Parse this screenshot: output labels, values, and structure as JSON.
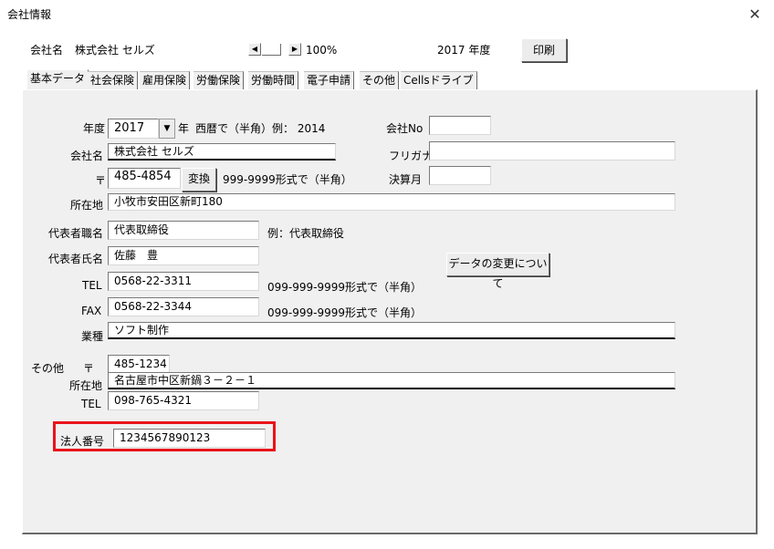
{
  "window": {
    "title": "会社情報",
    "close_icon": "close-icon"
  },
  "header": {
    "company_label": "会社名",
    "company_value": "株式会社 セルズ",
    "zoom": "100%",
    "year_display": "2017 年度",
    "print_label": "印刷"
  },
  "tabs": [
    {
      "label": "基本データ",
      "active": true
    },
    {
      "label": "社会保険"
    },
    {
      "label": "雇用保険"
    },
    {
      "label": "労働保険"
    },
    {
      "label": "労働時間"
    },
    {
      "label": "電子申請"
    },
    {
      "label": "その他"
    },
    {
      "label": "Cellsドライブ"
    }
  ],
  "form": {
    "year_label": "年度",
    "year_value": "2017",
    "year_suffix": "年",
    "year_hint": "西暦で（半角）例： 2014",
    "company_no_label": "会社No",
    "company_no_value": "",
    "company_name_label": "会社名",
    "company_name_value": "株式会社 セルズ",
    "furigana_label": "フリガナ",
    "furigana_value": "",
    "postal_label": "〒",
    "postal_value": "485-4854",
    "convert_label": "変換",
    "postal_hint": "999-9999形式で（半角）",
    "closing_month_label": "決算月",
    "closing_month_value": "",
    "address_label": "所在地",
    "address_value": "小牧市安田区新町180",
    "rep_title_label": "代表者職名",
    "rep_title_value": "代表取締役",
    "rep_title_hint": "例：代表取締役",
    "rep_name_label": "代表者氏名",
    "rep_name_value": "佐藤　豊",
    "data_change_label": "データの変更について",
    "tel_label": "TEL",
    "tel_value": "0568-22-3311",
    "tel_hint": "099-999-9999形式で（半角）",
    "fax_label": "FAX",
    "fax_value": "0568-22-3344",
    "fax_hint": "099-999-9999形式で（半角）",
    "industry_label": "業種",
    "industry_value": "ソフト制作",
    "other_label": "その他",
    "other_postal_label": "〒",
    "other_postal_value": "485-1234",
    "other_address_label": "所在地",
    "other_address_value": "名古屋市中区新鍋３－２－１",
    "other_tel_label": "TEL",
    "other_tel_value": "098-765-4321",
    "corp_number_label": "法人番号",
    "corp_number_value": "1234567890123"
  },
  "colors": {
    "highlight": "#e8141a",
    "panel": "#f0f0f0"
  }
}
